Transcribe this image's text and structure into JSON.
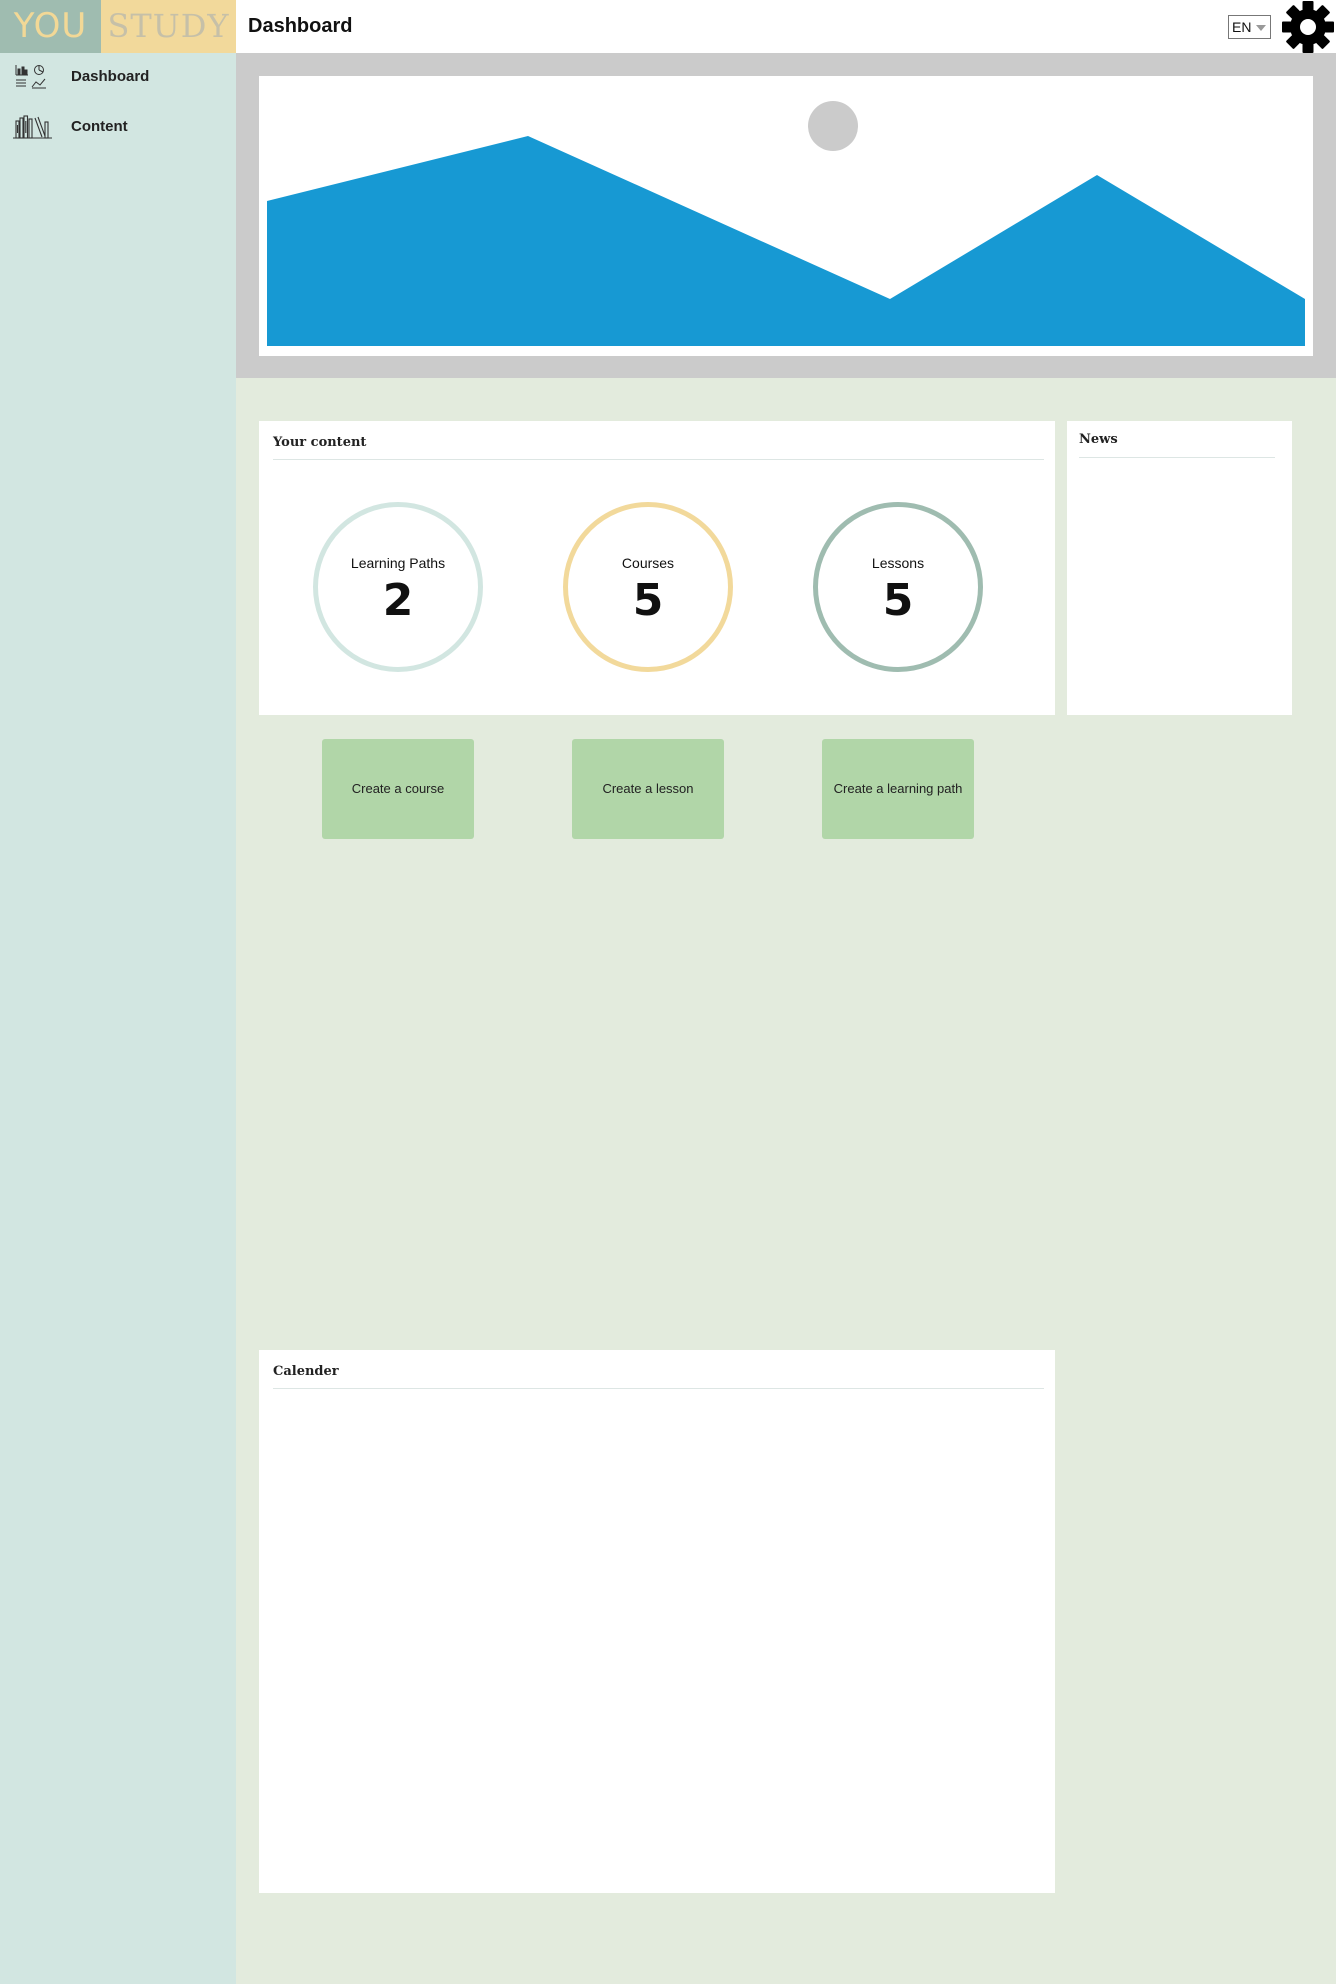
{
  "header": {
    "logo_left": "YOU",
    "logo_right": "STUDY",
    "title": "Dashboard",
    "language": "EN",
    "settings_icon": "gear-icon"
  },
  "sidebar": {
    "items": [
      {
        "label": "Dashboard",
        "icon": "dashboard-charts-icon"
      },
      {
        "label": "Content",
        "icon": "books-icon"
      }
    ]
  },
  "hero": {
    "image_icon": "image-placeholder-icon"
  },
  "your_content": {
    "title": "Your content",
    "stats": [
      {
        "label": "Learning Paths",
        "value": "2",
        "color": "#d2e6e1"
      },
      {
        "label": "Courses",
        "value": "5",
        "color": "#f2d99b"
      },
      {
        "label": "Lessons",
        "value": "5",
        "color": "#9fbcb0"
      }
    ]
  },
  "news": {
    "title": "News"
  },
  "actions": {
    "create_course": "Create a course",
    "create_lesson": "Create a lesson",
    "create_learning_path": "Create a learning path"
  },
  "calendar": {
    "title": "Calender"
  },
  "colors": {
    "accent_blue": "#1799d3",
    "button_green": "#b1d6a8",
    "page_bg": "#e3ebdd",
    "sidebar_bg": "#d2e6e1"
  }
}
